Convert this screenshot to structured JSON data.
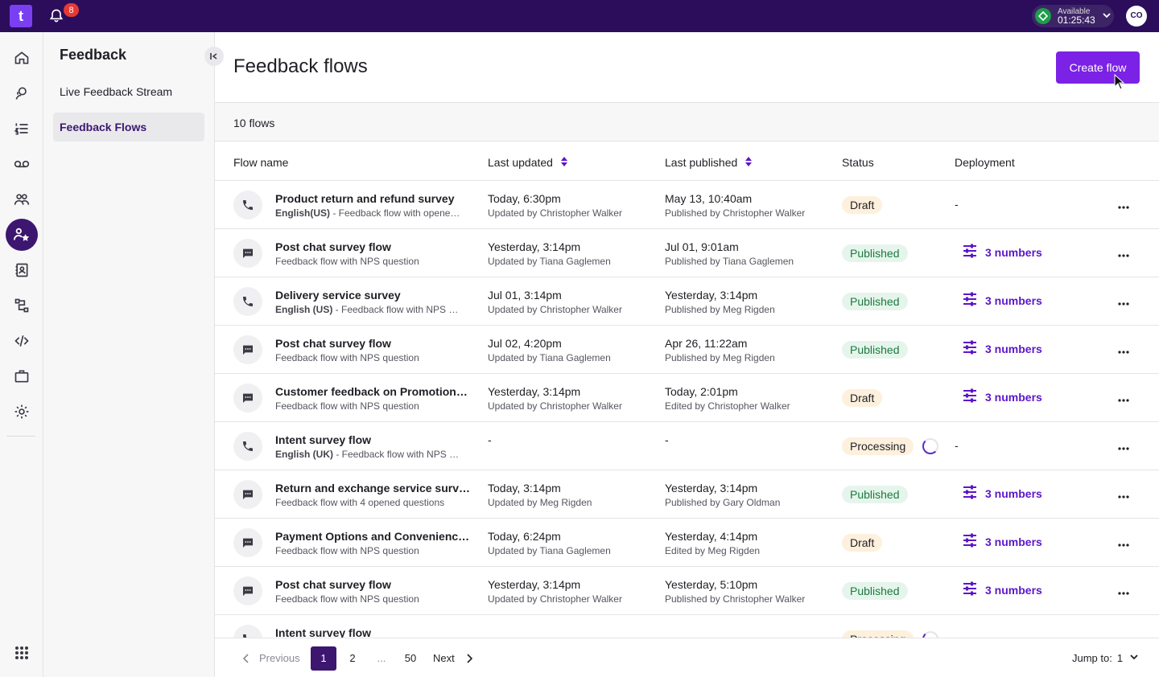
{
  "topbar": {
    "logo": "t",
    "notification_count": "8",
    "availability_status": "Available",
    "availability_timer": "01:25:43",
    "user_initials": "CO"
  },
  "subnav": {
    "title": "Feedback",
    "items": [
      {
        "label": "Live Feedback Stream"
      },
      {
        "label": "Feedback Flows"
      }
    ]
  },
  "main": {
    "title": "Feedback flows",
    "create_button": "Create flow",
    "flow_count": "10 flows",
    "columns": [
      "Flow name",
      "Last updated",
      "Last published",
      "Status",
      "Deployment"
    ]
  },
  "rows": [
    {
      "channel": "phone-icon",
      "name": "Product return and refund survey",
      "lang": "English(US)",
      "desc": " - Feedback flow with opened questions",
      "updated": "Today, 6:30pm",
      "updated_by": "Updated by Christopher Walker",
      "published": "May 13, 10:40am",
      "published_by": "Published by Christopher Walker",
      "status": "Draft",
      "deployment": "-"
    },
    {
      "channel": "chat-icon",
      "name": "Post chat survey flow",
      "lang": "",
      "desc": "Feedback flow with NPS question",
      "updated": "Yesterday, 3:14pm",
      "updated_by": "Updated by Tiana Gaglemen",
      "published": "Jul 01, 9:01am",
      "published_by": "Published by Tiana Gaglemen",
      "status": "Published",
      "deployment": "3 numbers"
    },
    {
      "channel": "phone-icon",
      "name": "Delivery service survey",
      "lang": "English (US)",
      "desc": " - Feedback flow with NPS question",
      "updated": "Jul 01, 3:14pm",
      "updated_by": "Updated by Christopher Walker",
      "published": "Yesterday, 3:14pm",
      "published_by": "Published by Meg Rigden",
      "status": "Published",
      "deployment": "3 numbers"
    },
    {
      "channel": "chat-icon",
      "name": "Post chat survey flow",
      "lang": "",
      "desc": "Feedback flow with NPS question",
      "updated": "Jul 02, 4:20pm",
      "updated_by": "Updated by Tiana Gaglemen",
      "published": "Apr 26, 11:22am",
      "published_by": "Published by Meg Rigden",
      "status": "Published",
      "deployment": "3 numbers"
    },
    {
      "channel": "chat-icon",
      "name": "Customer feedback on Promotions and Offers",
      "lang": "",
      "desc": "Feedback flow with NPS question",
      "updated": "Yesterday, 3:14pm",
      "updated_by": "Updated by Christopher Walker",
      "published": "Today, 2:01pm",
      "published_by": "Edited by Christopher Walker",
      "status": "Draft",
      "deployment": "3 numbers"
    },
    {
      "channel": "phone-icon",
      "name": "Intent survey flow",
      "lang": "English (UK)",
      "desc": " - Feedback flow with NPS question",
      "updated": "-",
      "updated_by": "",
      "published": "-",
      "published_by": "",
      "status": "Processing",
      "deployment": "-"
    },
    {
      "channel": "chat-icon",
      "name": "Return and exchange service survey",
      "lang": "",
      "desc": "Feedback flow with 4 opened questions",
      "updated": "Today, 3:14pm",
      "updated_by": "Updated by Meg Rigden",
      "published": "Yesterday, 3:14pm",
      "published_by": "Published by Gary Oldman",
      "status": "Published",
      "deployment": "3 numbers"
    },
    {
      "channel": "chat-icon",
      "name": "Payment Options and Convenience Survey",
      "lang": "",
      "desc": "Feedback flow with NPS question",
      "updated": "Today, 6:24pm",
      "updated_by": "Updated by Tiana Gaglemen",
      "published": "Yesterday, 4:14pm",
      "published_by": "Edited by Meg Rigden",
      "status": "Draft",
      "deployment": "3 numbers"
    },
    {
      "channel": "chat-icon",
      "name": "Post chat survey flow",
      "lang": "",
      "desc": "Feedback flow with NPS question",
      "updated": "Yesterday, 3:14pm",
      "updated_by": "Updated by Christopher Walker",
      "published": "Yesterday, 5:10pm",
      "published_by": "Published by Christopher Walker",
      "status": "Published",
      "deployment": "3 numbers"
    },
    {
      "channel": "phone-icon",
      "name": "Intent survey flow",
      "lang": "",
      "desc": "",
      "updated": "",
      "updated_by": "",
      "published": "",
      "published_by": "",
      "status": "Processing",
      "deployment": ""
    }
  ],
  "pagination": {
    "previous": "Previous",
    "pages": [
      "1",
      "2",
      "...",
      "50"
    ],
    "next": "Next",
    "jump_label": "Jump to:",
    "jump_value": "1"
  },
  "colors": {
    "topbar": "#2b0d5c",
    "accent": "#7b22e6",
    "active_nav": "#3d1670",
    "published": "#1a7a3d",
    "draft_bg": "#fdf0dd"
  }
}
